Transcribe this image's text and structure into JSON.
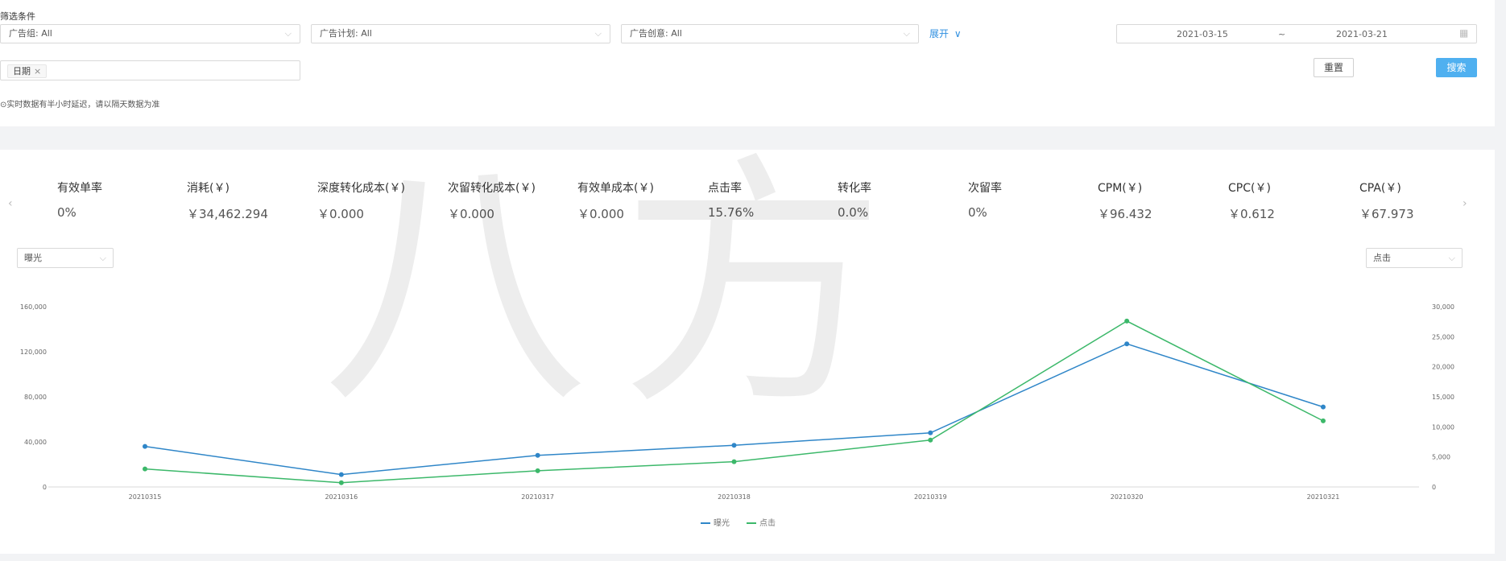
{
  "filters": {
    "title": "筛选条件",
    "ad_group": "广告组: All",
    "ad_plan": "广告计划: All",
    "ad_creative": "广告创意: All",
    "expand": "展开",
    "date_start": "2021-03-15",
    "date_sep": "~",
    "date_end": "2021-03-21",
    "tag": "日期",
    "reset": "重置",
    "search": "搜索",
    "notice": "⊙实时数据有半小时延迟，请以隔天数据为准"
  },
  "metrics": [
    {
      "label": "有效单率",
      "value": "0%"
    },
    {
      "label": "消耗(￥)",
      "value": "￥34,462.294"
    },
    {
      "label": "深度转化成本(￥)",
      "value": "￥0.000"
    },
    {
      "label": "次留转化成本(￥)",
      "value": "￥0.000"
    },
    {
      "label": "有效单成本(￥)",
      "value": "￥0.000"
    },
    {
      "label": "点击率",
      "value": "15.76%"
    },
    {
      "label": "转化率",
      "value": "0.0%"
    },
    {
      "label": "次留率",
      "value": "0%"
    },
    {
      "label": "CPM(￥)",
      "value": "￥96.432"
    },
    {
      "label": "CPC(￥)",
      "value": "￥0.612"
    },
    {
      "label": "CPA(￥)",
      "value": "￥67.973"
    }
  ],
  "left_metric_select": "曝光",
  "right_metric_select": "点击",
  "watermark": "八方",
  "colors": {
    "series1": "#2f86c8",
    "series2": "#3cb86a",
    "search_button": "#4fb0f0",
    "link": "#2f8fe0"
  },
  "chart_data": {
    "type": "line",
    "x": [
      "20210315",
      "20210316",
      "20210317",
      "20210318",
      "20210319",
      "20210320",
      "20210321"
    ],
    "series": [
      {
        "name": "曝光",
        "axis": "left",
        "values": [
          36000,
          11000,
          28000,
          37000,
          48000,
          127000,
          71000
        ]
      },
      {
        "name": "点击",
        "axis": "right",
        "values": [
          3000,
          700,
          2700,
          4200,
          7800,
          27600,
          11000
        ]
      }
    ],
    "y_left": {
      "ticks": [
        "0",
        "40,000",
        "80,000",
        "120,000",
        "160,000"
      ],
      "range": [
        0,
        160000
      ]
    },
    "y_right": {
      "ticks": [
        "0",
        "5,000",
        "10,000",
        "15,000",
        "20,000",
        "25,000",
        "30,000"
      ],
      "range": [
        0,
        30000
      ]
    },
    "legend": "bottom",
    "grid": false
  }
}
